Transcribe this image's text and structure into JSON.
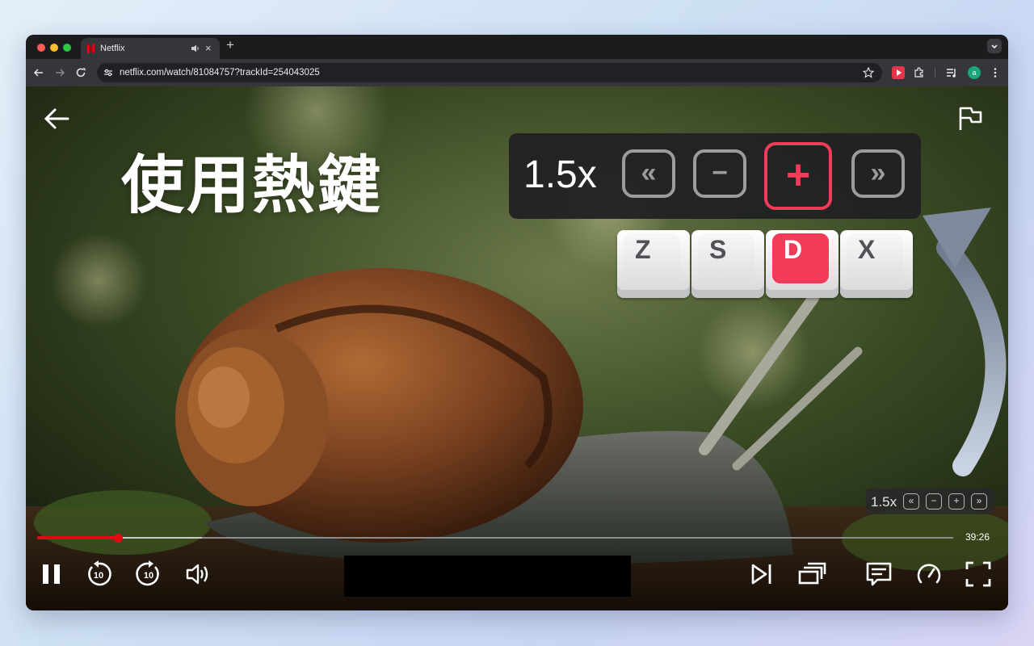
{
  "browser": {
    "tab_title": "Netflix",
    "tab_close": "×",
    "new_tab": "+",
    "url": "netflix.com/watch/81084757?trackId=254043025",
    "profile_initial": "a"
  },
  "player": {
    "headline": "使用熱鍵",
    "speed_panel": {
      "speed": "1.5x",
      "buttons": [
        "«",
        "−",
        "+",
        "»"
      ]
    },
    "hotkeys": [
      "Z",
      "S",
      "D",
      "X"
    ],
    "mini_panel": {
      "speed": "1.5x",
      "buttons": [
        "«",
        "−",
        "+",
        "»"
      ]
    },
    "progress_fraction": 0.088,
    "buffered_fraction": 0.18,
    "remaining_time": "39:26",
    "accent": "#e50914",
    "hotkey_accent": "#f23b59"
  },
  "icons": [
    "back-arrow-icon",
    "flag-icon",
    "pause-icon",
    "rewind-10-icon",
    "forward-10-icon",
    "volume-icon",
    "next-episode-icon",
    "episodes-icon",
    "subtitles-icon",
    "speed-icon",
    "fullscreen-icon"
  ]
}
